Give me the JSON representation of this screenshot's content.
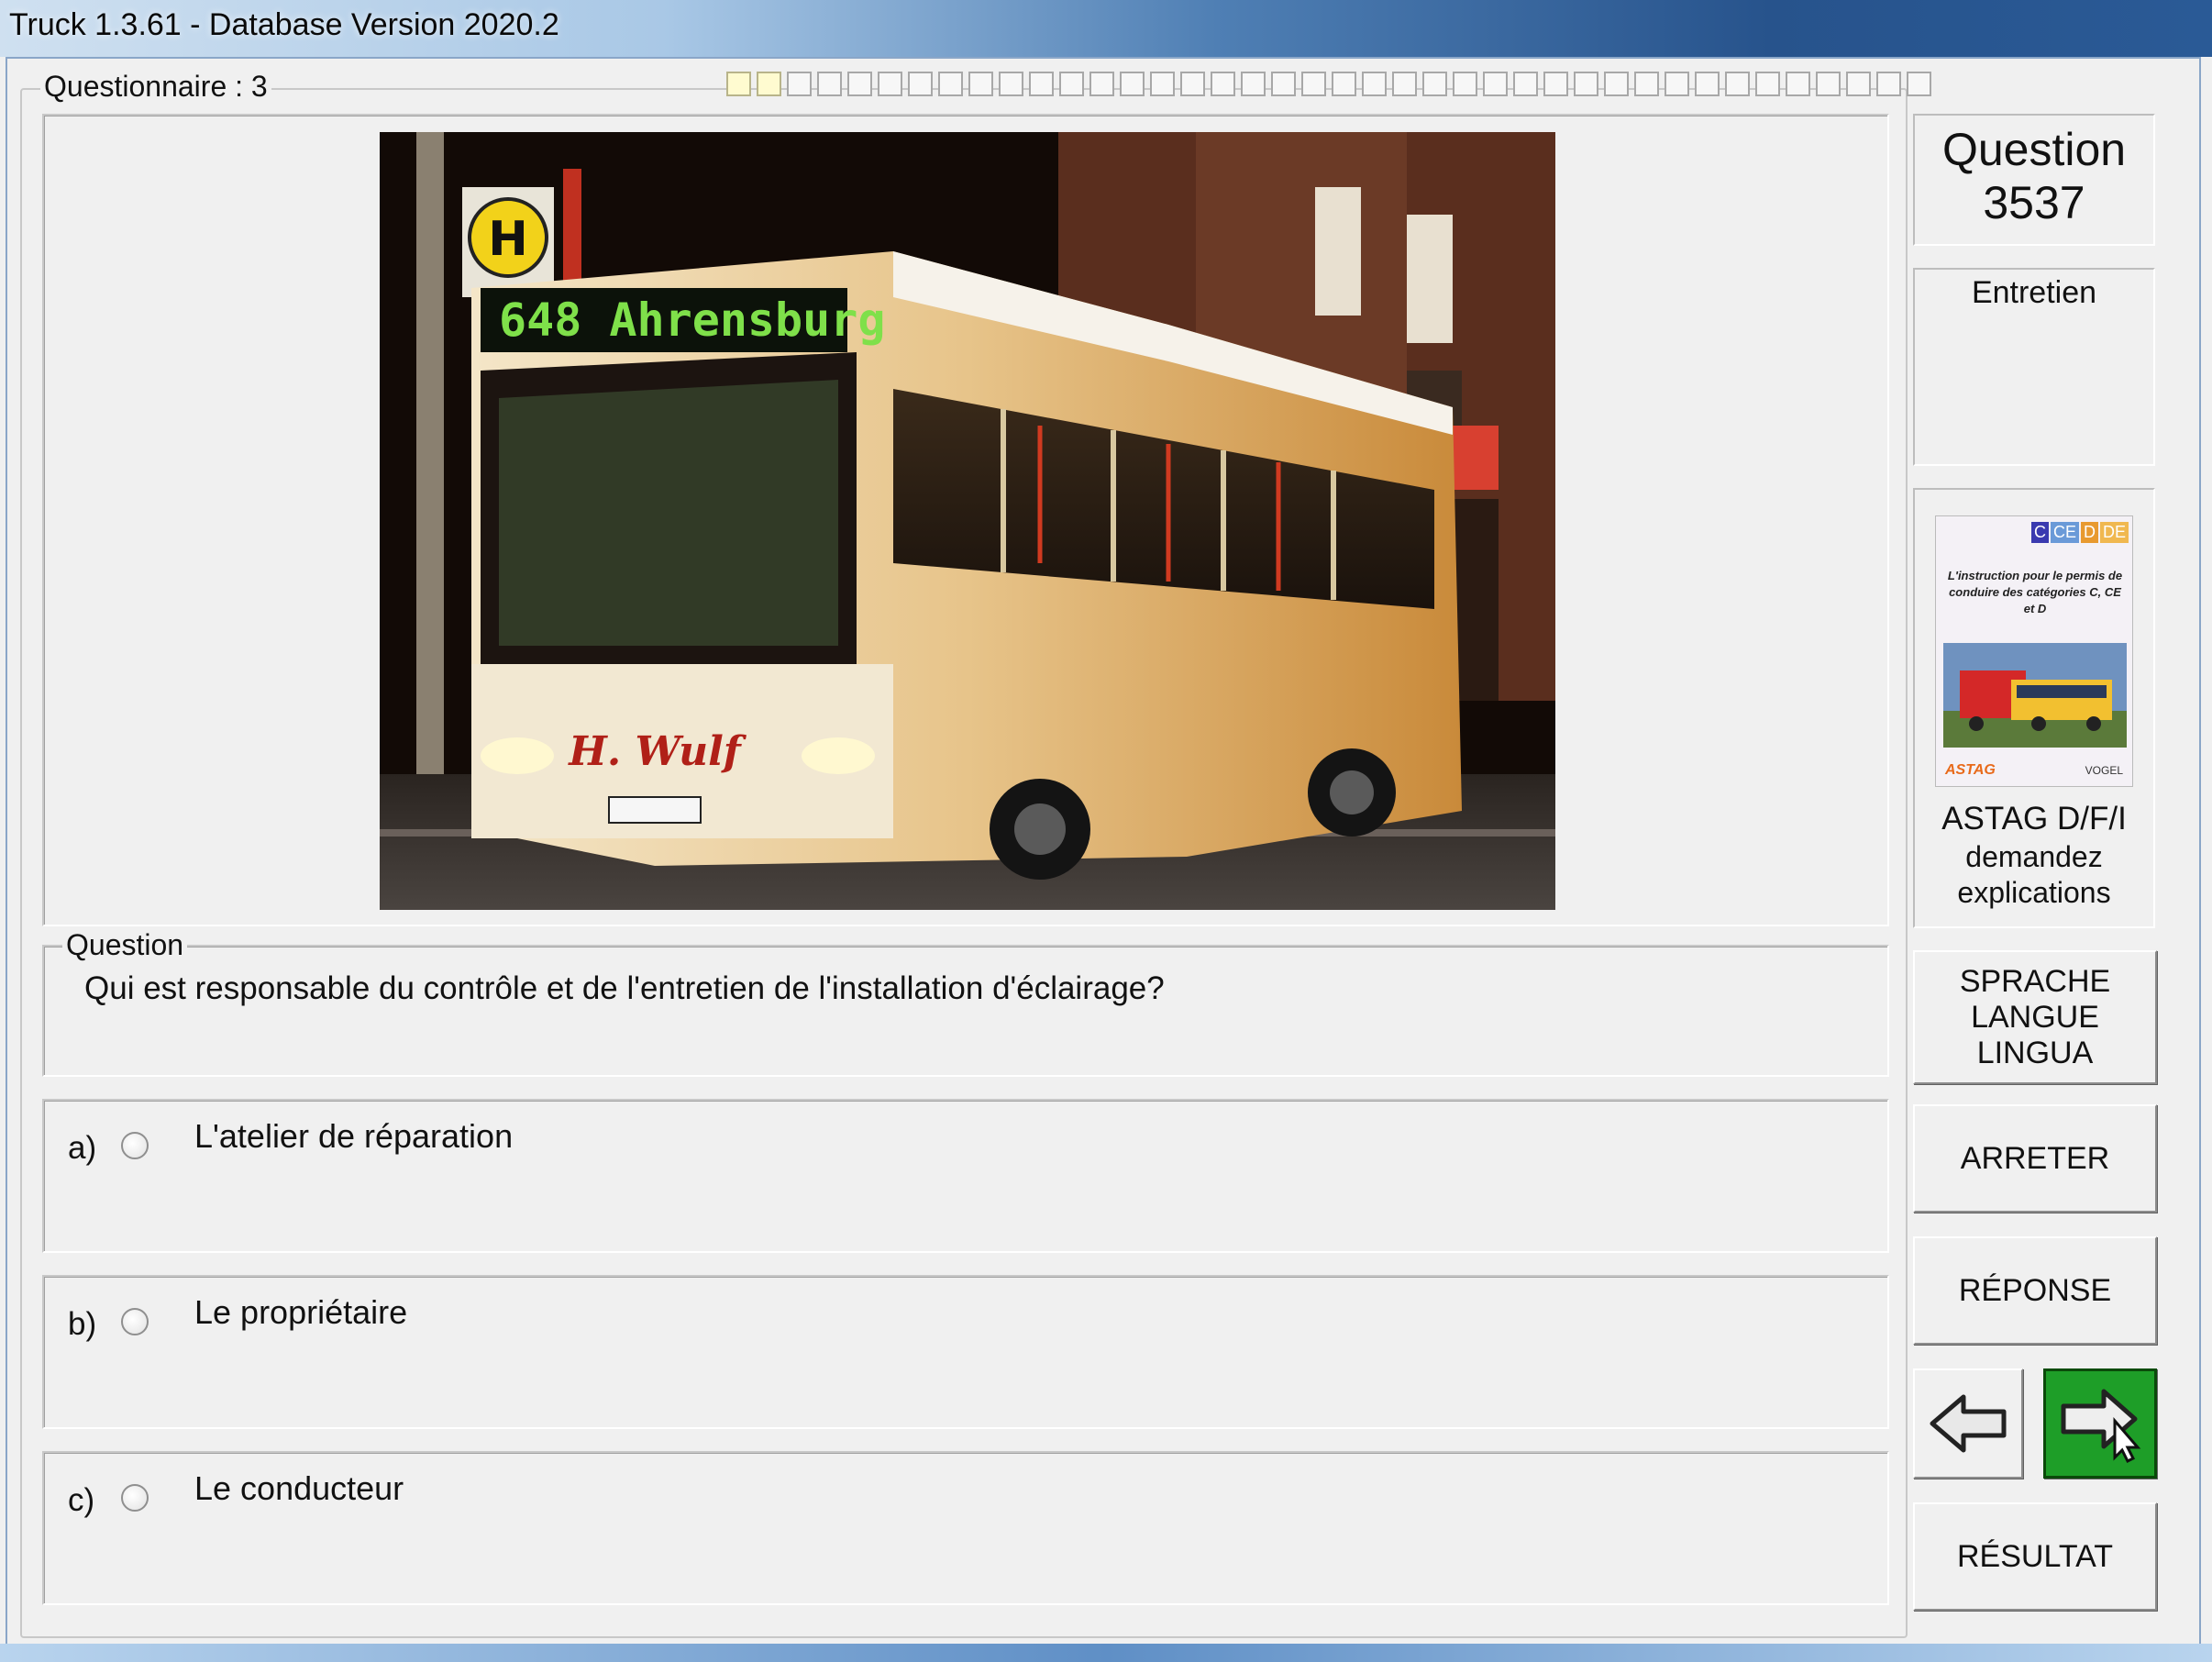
{
  "window": {
    "title": "Truck 1.3.61 - Database Version 2020.2"
  },
  "questionnaire": {
    "label": "Questionnaire : 3",
    "progress_total": 40,
    "progress_done": 2
  },
  "question": {
    "number_label": "Question",
    "number": "3537",
    "category": "Entretien",
    "group_label": "Question",
    "text": "Qui est responsable du contrôle et de l'entretien de l'installation d'éclairage?"
  },
  "answers": [
    {
      "letter": "a)",
      "text": "L'atelier de réparation",
      "selected": false
    },
    {
      "letter": "b)",
      "text": "Le propriétaire",
      "selected": false
    },
    {
      "letter": "c)",
      "text": "Le conducteur",
      "selected": false
    }
  ],
  "image": {
    "destination_sign": "648 Ahrensburg",
    "stop_sign": "H",
    "company_name": "H. Wulf"
  },
  "book": {
    "categories": [
      "C",
      "CE",
      "D",
      "DE"
    ],
    "caption": "L'instruction pour le permis de conduire des catégories C, CE et D",
    "brand_left": "ASTAG",
    "brand_right": "VOGEL",
    "publisher": "ASTAG D/F/I",
    "hint_line1": "demandez",
    "hint_line2": "explications"
  },
  "buttons": {
    "language_line1": "SPRACHE",
    "language_line2": "LANGUE",
    "language_line3": "LINGUA",
    "stop": "ARRETER",
    "answer": "RÉPONSE",
    "result": "RÉSULTAT"
  },
  "colors": {
    "next_button": "#1e9e28",
    "progress_done": "#fffbd0"
  },
  "icons": {
    "prev": "arrow-left-icon",
    "next": "arrow-right-icon"
  }
}
